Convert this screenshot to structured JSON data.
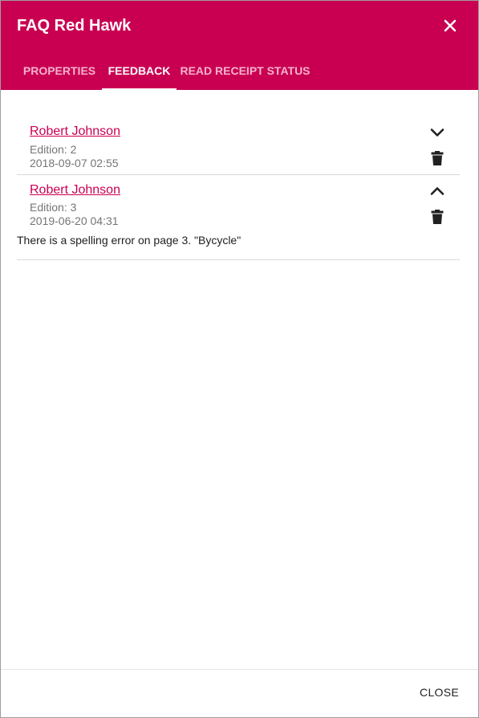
{
  "dialog": {
    "title": "FAQ Red Hawk"
  },
  "tabs": [
    {
      "label": "PROPERTIES",
      "active": false
    },
    {
      "label": "FEEDBACK",
      "active": true
    },
    {
      "label": "READ RECEIPT STATUS",
      "active": false
    }
  ],
  "feedback": [
    {
      "author": "Robert Johnson",
      "edition": "Edition: 2",
      "timestamp": "2018-09-07 02:55",
      "expanded": false,
      "toggle_icon": "chevron-down-icon",
      "delete_icon": "trash-icon"
    },
    {
      "author": "Robert Johnson",
      "edition": "Edition: 3",
      "timestamp": "2019-06-20 04:31",
      "expanded": true,
      "toggle_icon": "chevron-up-icon",
      "delete_icon": "trash-icon",
      "message": "There is a spelling error on page 3. \"Bycycle\""
    }
  ],
  "footer": {
    "close_label": "CLOSE"
  },
  "colors": {
    "brand": "#c90052",
    "tab_inactive": "#f5b3cd",
    "link": "#c90052",
    "meta_text": "#757575"
  }
}
